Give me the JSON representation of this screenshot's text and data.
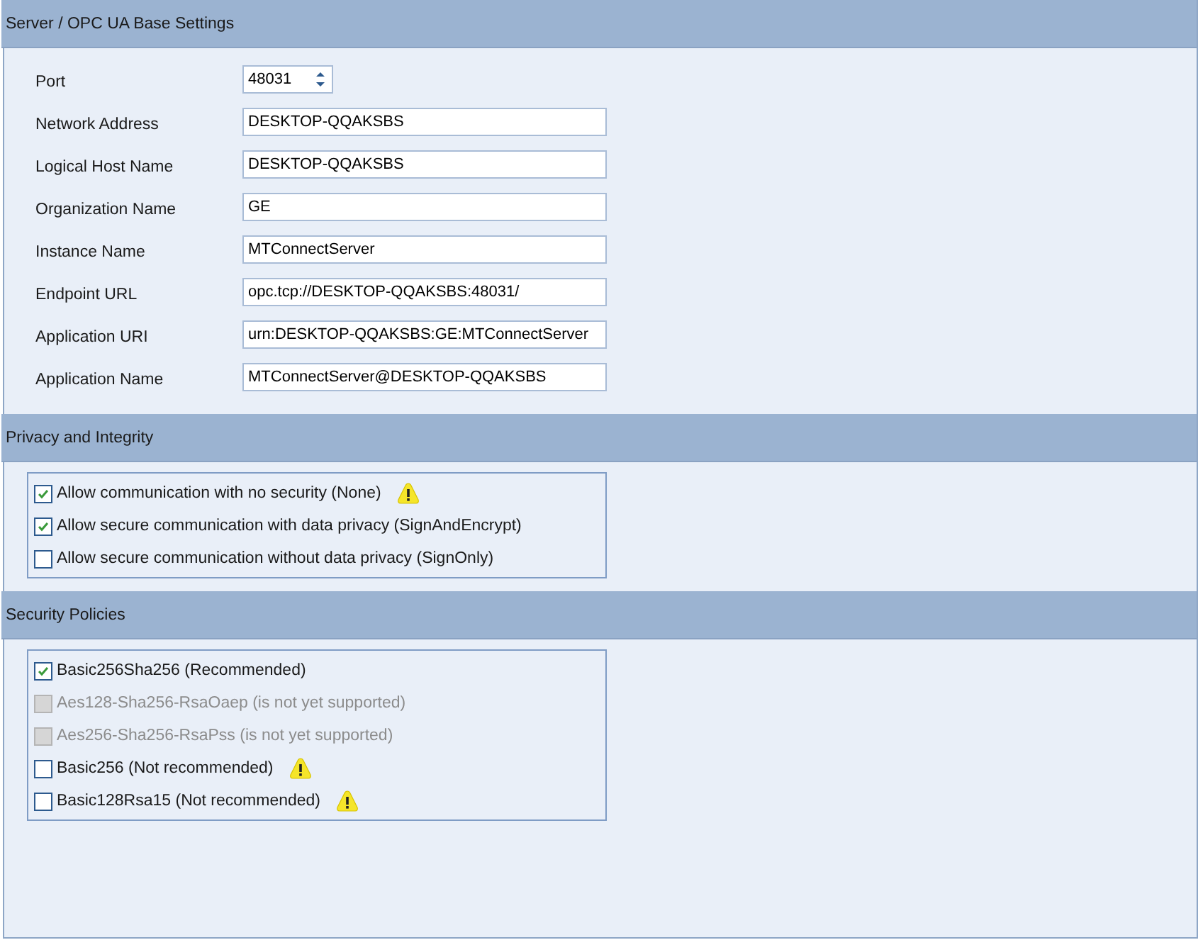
{
  "sections": [
    {
      "title": "Server / OPC UA Base Settings",
      "kind": "form",
      "fields": [
        {
          "label": "Port",
          "value": "48031",
          "kind": "spinner"
        },
        {
          "label": "Network Address",
          "value": "DESKTOP-QQAKSBS",
          "kind": "text"
        },
        {
          "label": "Logical Host Name",
          "value": "DESKTOP-QQAKSBS",
          "kind": "text"
        },
        {
          "label": "Organization Name",
          "value": "GE",
          "kind": "text"
        },
        {
          "label": "Instance Name",
          "value": "MTConnectServer",
          "kind": "text"
        },
        {
          "label": "Endpoint URL",
          "value": "opc.tcp://DESKTOP-QQAKSBS:48031/",
          "kind": "text"
        },
        {
          "label": "Application URI",
          "value": "urn:DESKTOP-QQAKSBS:GE:MTConnectServer",
          "kind": "text"
        },
        {
          "label": "Application Name",
          "value": "MTConnectServer@DESKTOP-QQAKSBS",
          "kind": "text"
        }
      ]
    },
    {
      "title": "Privacy and Integrity",
      "kind": "checks",
      "options": [
        {
          "label": "Allow communication with no security (None)",
          "checked": true,
          "disabled": false,
          "warning": true
        },
        {
          "label": "Allow secure communication with data privacy (SignAndEncrypt)",
          "checked": true,
          "disabled": false,
          "warning": false
        },
        {
          "label": "Allow secure communication without data privacy (SignOnly)",
          "checked": false,
          "disabled": false,
          "warning": false
        }
      ]
    },
    {
      "title": "Security Policies",
      "kind": "checks",
      "options": [
        {
          "label": "Basic256Sha256 (Recommended)",
          "checked": true,
          "disabled": false,
          "warning": false
        },
        {
          "label": "Aes128-Sha256-RsaOaep (is not yet supported)",
          "checked": false,
          "disabled": true,
          "warning": false
        },
        {
          "label": "Aes256-Sha256-RsaPss (is not yet supported)",
          "checked": false,
          "disabled": true,
          "warning": false
        },
        {
          "label": "Basic256 (Not recommended)",
          "checked": false,
          "disabled": false,
          "warning": true
        },
        {
          "label": "Basic128Rsa15 (Not recommended)",
          "checked": false,
          "disabled": false,
          "warning": true
        }
      ]
    }
  ]
}
